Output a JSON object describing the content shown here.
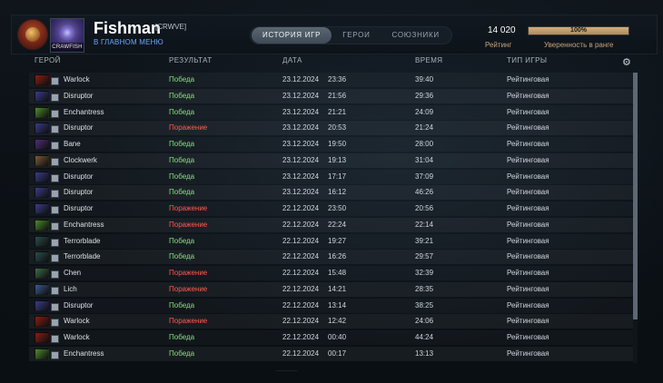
{
  "header": {
    "player_name": "Fishman",
    "clan_tag": "[CRWVE]",
    "status": "В ГЛАВНОМ МЕНЮ",
    "avatar_text": "CRAWFISH",
    "rating_value": "14 020",
    "rating_label": "Рейтинг",
    "confidence_text": "100%",
    "confidence_value": 1.0,
    "confidence_label": "Уверенность в ранге"
  },
  "tabs": [
    {
      "label": "ИСТОРИЯ ИГР",
      "active": true
    },
    {
      "label": "ГЕРОИ",
      "active": false
    },
    {
      "label": "СОЮЗНИКИ",
      "active": false
    }
  ],
  "table": {
    "columns": {
      "hero": "ГЕРОЙ",
      "result": "РЕЗУЛЬТАТ",
      "date": "ДАТА",
      "duration": "ВРЕМЯ",
      "type": "ТИП ИГРЫ"
    },
    "rows": [
      {
        "hero": "Warlock",
        "result": "Победа",
        "result_kind": "win",
        "date": "23.12.2024",
        "time": "23:36",
        "duration": "39:40",
        "type": "Рейтинговая",
        "hero_color": "#8a1d12"
      },
      {
        "hero": "Disruptor",
        "result": "Победа",
        "result_kind": "win",
        "date": "23.12.2024",
        "time": "21:56",
        "duration": "29:36",
        "type": "Рейтинговая",
        "hero_color": "#3a3c8a"
      },
      {
        "hero": "Enchantress",
        "result": "Победа",
        "result_kind": "win",
        "date": "23.12.2024",
        "time": "21:21",
        "duration": "24:09",
        "type": "Рейтинговая",
        "hero_color": "#4f8a2d"
      },
      {
        "hero": "Disruptor",
        "result": "Поражение",
        "result_kind": "loss",
        "date": "23.12.2024",
        "time": "20:53",
        "duration": "21:24",
        "type": "Рейтинговая",
        "hero_color": "#3a3c8a"
      },
      {
        "hero": "Bane",
        "result": "Победа",
        "result_kind": "win",
        "date": "23.12.2024",
        "time": "19:50",
        "duration": "28:00",
        "type": "Рейтинговая",
        "hero_color": "#4e2f7a"
      },
      {
        "hero": "Clockwerk",
        "result": "Победа",
        "result_kind": "win",
        "date": "23.12.2024",
        "time": "19:13",
        "duration": "31:04",
        "type": "Рейтинговая",
        "hero_color": "#7a5b3a"
      },
      {
        "hero": "Disruptor",
        "result": "Победа",
        "result_kind": "win",
        "date": "23.12.2024",
        "time": "17:17",
        "duration": "37:09",
        "type": "Рейтинговая",
        "hero_color": "#3a3c8a"
      },
      {
        "hero": "Disruptor",
        "result": "Победа",
        "result_kind": "win",
        "date": "23.12.2024",
        "time": "16:12",
        "duration": "46:26",
        "type": "Рейтинговая",
        "hero_color": "#3a3c8a"
      },
      {
        "hero": "Disruptor",
        "result": "Поражение",
        "result_kind": "loss",
        "date": "22.12.2024",
        "time": "23:50",
        "duration": "20:56",
        "type": "Рейтинговая",
        "hero_color": "#3a3c8a"
      },
      {
        "hero": "Enchantress",
        "result": "Поражение",
        "result_kind": "loss",
        "date": "22.12.2024",
        "time": "22:24",
        "duration": "22:14",
        "type": "Рейтинговая",
        "hero_color": "#4f8a2d"
      },
      {
        "hero": "Terrorblade",
        "result": "Победа",
        "result_kind": "win",
        "date": "22.12.2024",
        "time": "19:27",
        "duration": "39:21",
        "type": "Рейтинговая",
        "hero_color": "#2a4d4d"
      },
      {
        "hero": "Terrorblade",
        "result": "Победа",
        "result_kind": "win",
        "date": "22.12.2024",
        "time": "16:26",
        "duration": "29:57",
        "type": "Рейтинговая",
        "hero_color": "#2a4d4d"
      },
      {
        "hero": "Chen",
        "result": "Поражение",
        "result_kind": "loss",
        "date": "22.12.2024",
        "time": "15:48",
        "duration": "32:39",
        "type": "Рейтинговая",
        "hero_color": "#3d6b4c"
      },
      {
        "hero": "Lich",
        "result": "Поражение",
        "result_kind": "loss",
        "date": "22.12.2024",
        "time": "14:21",
        "duration": "28:35",
        "type": "Рейтинговая",
        "hero_color": "#3d5a8f"
      },
      {
        "hero": "Disruptor",
        "result": "Победа",
        "result_kind": "win",
        "date": "22.12.2024",
        "time": "13:14",
        "duration": "38:25",
        "type": "Рейтинговая",
        "hero_color": "#3a3c8a"
      },
      {
        "hero": "Warlock",
        "result": "Поражение",
        "result_kind": "loss",
        "date": "22.12.2024",
        "time": "12:42",
        "duration": "24:06",
        "type": "Рейтинговая",
        "hero_color": "#8a1d12"
      },
      {
        "hero": "Warlock",
        "result": "Победа",
        "result_kind": "win",
        "date": "22.12.2024",
        "time": "00:40",
        "duration": "44:24",
        "type": "Рейтинговая",
        "hero_color": "#8a1d12"
      },
      {
        "hero": "Enchantress",
        "result": "Победа",
        "result_kind": "win",
        "date": "22.12.2024",
        "time": "00:17",
        "duration": "13:13",
        "type": "Рейтинговая",
        "hero_color": "#4f8a2d"
      }
    ]
  },
  "icons": {
    "settings": "gear-icon",
    "rank": "rank-medal-icon",
    "mode": "ranked-mode-icon"
  },
  "colors": {
    "win": "#86e17b",
    "loss": "#ff5b4d",
    "accent_gold": "#c6a47a",
    "active_tab": "#4f5a66"
  }
}
